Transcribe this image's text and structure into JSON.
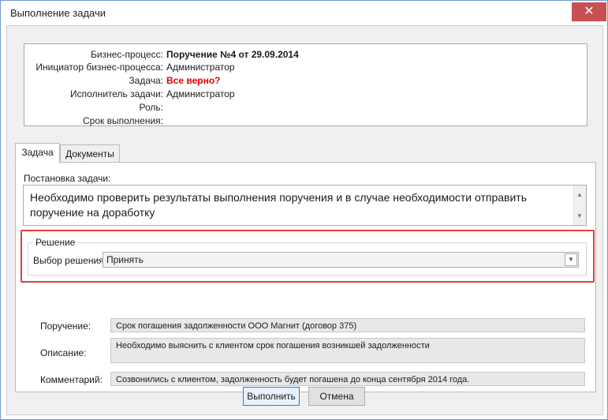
{
  "window": {
    "title": "Выполнение задачи",
    "close_glyph": "✕"
  },
  "info": {
    "rows": [
      {
        "label": "Бизнес-процесс:",
        "value": "Поручение №4 от 29.09.2014"
      },
      {
        "label": "Инициатор бизнес-процесса:",
        "value": "Администратор"
      },
      {
        "label": "Задача:",
        "value": "Все верно?"
      },
      {
        "label": "Исполнитель задачи:",
        "value": "Администратор"
      },
      {
        "label": "Роль:",
        "value": ""
      },
      {
        "label": "Срок выполнения:",
        "value": ""
      }
    ]
  },
  "tabs": [
    {
      "label": "Задача",
      "active": true
    },
    {
      "label": "Документы",
      "active": false
    }
  ],
  "task": {
    "label": "Постановка задачи:",
    "text": "Необходимо проверить результаты выполнения поручения и в случае необходимости отправить поручение на доработку"
  },
  "decision": {
    "group_title": "Решение",
    "select_label": "Выбор решения:",
    "selected": "Принять"
  },
  "fields": [
    {
      "label": "Поручение:",
      "value": "Срок погашения задолженности ООО Магнит (договор 375)"
    },
    {
      "label": "Описание:",
      "value": "Необходимо выяснить с клиентом срок погашения возникшей задолженности"
    },
    {
      "label": "Комментарий:",
      "value": "Созвонились с клиентом, задолженность будет погашена до конца сентября 2014 года."
    }
  ],
  "buttons": {
    "ok": "Выполнить",
    "cancel": "Отмена"
  },
  "colors": {
    "accent": "#e04040",
    "task_red": "#e00000",
    "close": "#c75050"
  }
}
